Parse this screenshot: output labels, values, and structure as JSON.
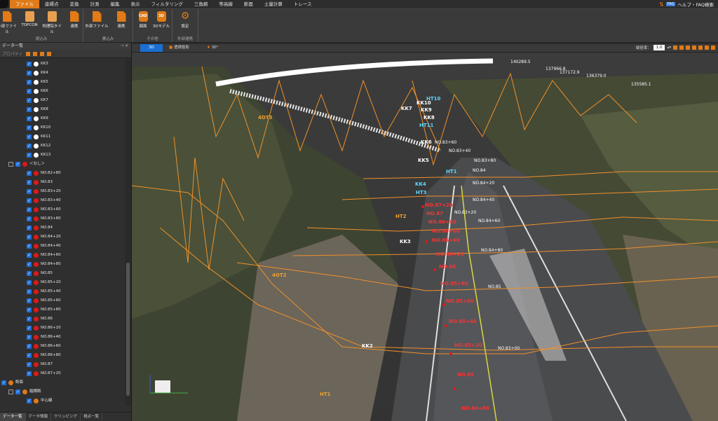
{
  "menubar": {
    "items": [
      "ファイル",
      "座標点",
      "変換",
      "計測",
      "編集",
      "表示",
      "フィルタリング",
      "三角網",
      "等高線",
      "断面",
      "土量計算",
      "トレース"
    ],
    "active_index": 0,
    "help_badge": "FAQ",
    "help_text": "ヘルプ・FAQ検索"
  },
  "ribbon": {
    "groups": [
      {
        "label": "読込み",
        "buttons": [
          "外部ファイル",
          "TOPCON",
          "地理院タイル",
          "連携"
        ]
      },
      {
        "label": "書込み",
        "buttons": [
          "外部ファイル",
          "連携"
        ]
      },
      {
        "label": "その他",
        "buttons": [
          "図面",
          "3Dモデル"
        ],
        "icon_text": [
          "CAD",
          "3D"
        ]
      },
      {
        "label": "外部連携",
        "buttons": [
          "設定"
        ]
      }
    ]
  },
  "panel": {
    "title": "データ一覧",
    "tools_label": "プロパティ",
    "kk_rows": [
      "KK3",
      "KK4",
      "KK5",
      "KK6",
      "KK7",
      "KK8",
      "KK9",
      "KK10",
      "KK11",
      "KK12",
      "KK13"
    ],
    "group_label": "＜なし＞",
    "no_rows": [
      "NO.82+80",
      "NO.83",
      "NO.83+20",
      "NO.83+40",
      "NO.83+60",
      "NO.83+80",
      "NO.84",
      "NO.84+20",
      "NO.84+40",
      "NO.84+60",
      "NO.84+80",
      "NO.85",
      "NO.85+20",
      "NO.85+40",
      "NO.85+60",
      "NO.85+80",
      "NO.86",
      "NO.86+20",
      "NO.86+40",
      "NO.86+60",
      "NO.86+80",
      "NO.87",
      "NO.87+20"
    ],
    "section_rows": [
      "断面",
      "縦横断",
      "中心線"
    ],
    "tabs": [
      "データ一覧",
      "データ情報",
      "クリッピング",
      "視点一覧"
    ]
  },
  "viewbar": {
    "tab_3d": "3D",
    "tab_projection": "透視投影",
    "tab_angle": "30°",
    "scale_label": "縦倍率：",
    "scale_value": "1.0"
  },
  "view": {
    "top_numbers": [
      "140289.5",
      "137966.8",
      "137172.9",
      "136379.0",
      "135585.1"
    ],
    "labels_white": [
      "KK3",
      "KK2",
      "KK4",
      "KK5",
      "KK6",
      "KK7",
      "KK8",
      "KK9",
      "KK10"
    ],
    "labels_cyan": [
      "KK4",
      "HT3",
      "HT1",
      "HT10",
      "HT11"
    ],
    "labels_orange": [
      "4OT2",
      "4OT3",
      "HT1",
      "HT2"
    ],
    "labels_red": [
      "NO.87+20",
      "NO.87",
      "NO.86+80",
      "NO.86+60",
      "NO.86+40",
      "NO.86+20",
      "NO.86",
      "NO.85+80",
      "NO.85+60",
      "NO.85+40",
      "NO.85+20",
      "NO.85",
      "NO.84+80"
    ],
    "labels_station": [
      "NO.83+40",
      "NO.83+60",
      "NO.83+80",
      "NO.84",
      "NO.84+20",
      "NO.84+40",
      "NO.84+60",
      "NO.84+80",
      "NO.85",
      "NO.83+20",
      "NO.83+00"
    ]
  },
  "colors": {
    "accent": "#e07b18",
    "selected": "#1c6fd2",
    "check": "#1e6fd8",
    "red_point": "#e01818"
  }
}
